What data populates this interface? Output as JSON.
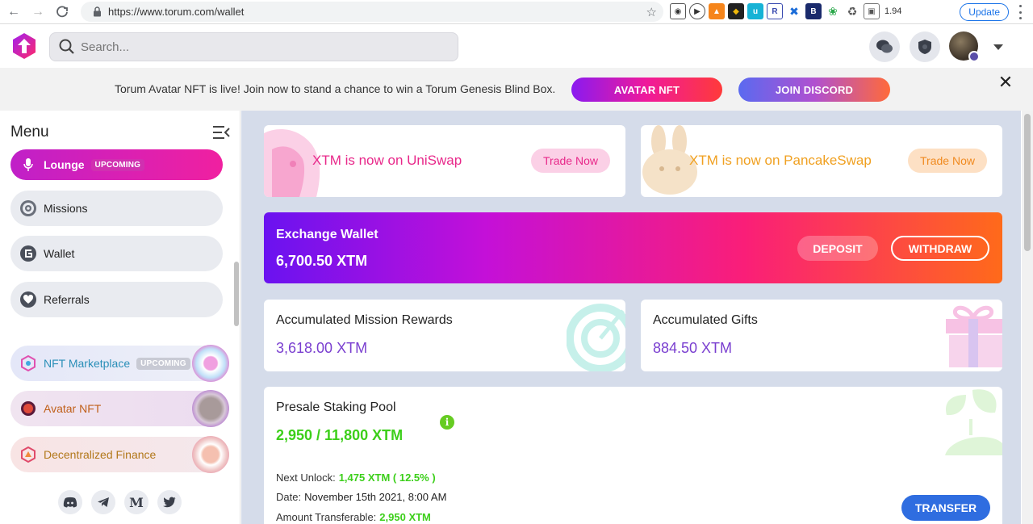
{
  "browser": {
    "url": "https://www.torum.com/wallet",
    "ext_counter": "1.94",
    "update_label": "Update"
  },
  "header": {
    "search_placeholder": "Search..."
  },
  "announcement": {
    "message": "Torum Avatar NFT is live! Join now to stand a chance to win a Torum Genesis Blind Box.",
    "avatar_nft_label": "AVATAR NFT",
    "join_discord_label": "JOIN DISCORD"
  },
  "sidebar": {
    "title": "Menu",
    "items": [
      {
        "label": "Lounge",
        "badge": "UPCOMING"
      },
      {
        "label": "Missions"
      },
      {
        "label": "Wallet"
      },
      {
        "label": "Referrals"
      }
    ],
    "special": [
      {
        "label": "NFT Marketplace",
        "badge": "UPCOMING",
        "color": "#2a8fb8"
      },
      {
        "label": "Avatar NFT",
        "color": "#c0601a"
      },
      {
        "label": "Decentralized Finance",
        "color": "#b2781a"
      }
    ]
  },
  "swaps": [
    {
      "text": "XTM is now on UniSwap",
      "button": "Trade Now",
      "color": "#e8288a"
    },
    {
      "text": "XTM is now on PancakeSwap",
      "button": "Trade Now",
      "color": "#f0a020"
    }
  ],
  "exchange_wallet": {
    "title": "Exchange Wallet",
    "amount": "6,700.50 XTM",
    "deposit_label": "DEPOSIT",
    "withdraw_label": "WITHDRAW"
  },
  "mission_rewards": {
    "title": "Accumulated Mission Rewards",
    "amount": "3,618.00 XTM"
  },
  "gifts": {
    "title": "Accumulated Gifts",
    "amount": "884.50 XTM"
  },
  "presale": {
    "title": "Presale Staking Pool",
    "amount": "2,950 / 11,800 XTM",
    "next_unlock_label": "Next Unlock:",
    "next_unlock_value": "1,475 XTM ( 12.5% )",
    "date_label": "Date:",
    "date_value": "November 15th 2021, 8:00 AM",
    "transferable_label": "Amount Transferable:",
    "transferable_value": "2,950 XTM",
    "transfer_label": "TRANSFER"
  },
  "colors": {
    "accent_purple": "#7a3fd0",
    "accent_green": "#3ccf1a",
    "transfer_blue": "#2f6de0"
  }
}
